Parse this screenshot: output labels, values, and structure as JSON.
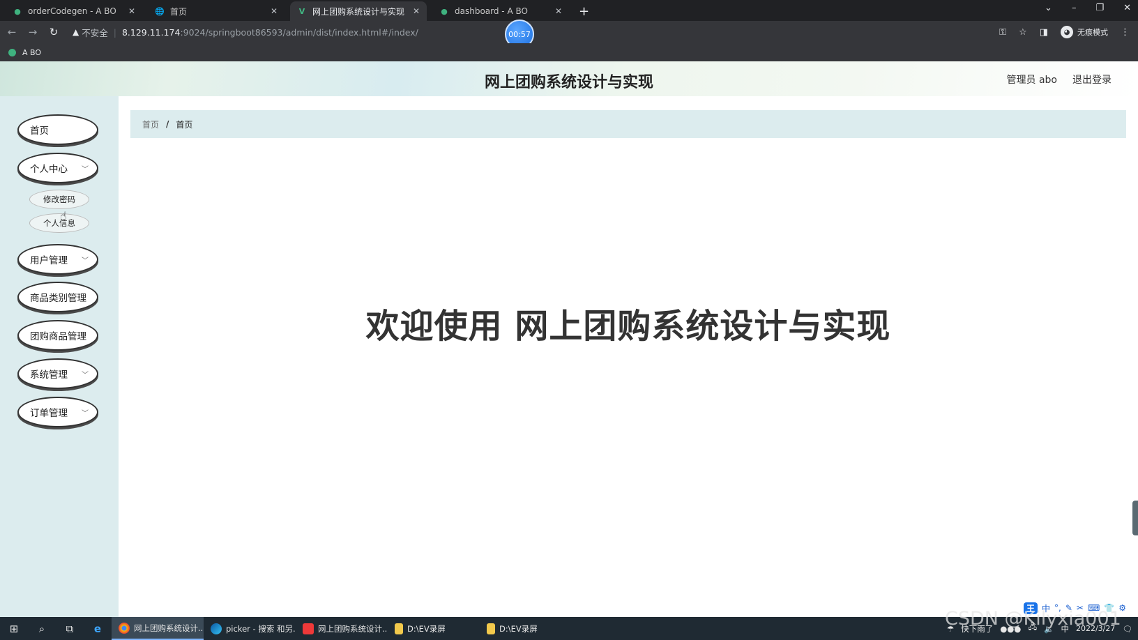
{
  "browser": {
    "tabs": [
      {
        "label": "orderCodegen - A BO",
        "active": false
      },
      {
        "label": "首页",
        "active": false
      },
      {
        "label": "网上团购系统设计与实现",
        "active": true
      },
      {
        "label": "dashboard - A BO",
        "active": false
      }
    ],
    "new_tab": "+",
    "address": {
      "insecure_label": "不安全",
      "host": "8.129.11.174",
      "path": ":9024/springboot86593/admin/dist/index.html#/index/"
    },
    "incognito_label": "无痕模式",
    "timer": "00:57",
    "bookmark": "A BO"
  },
  "app": {
    "title": "网上团购系统设计与实现",
    "user_label": "管理员 abo",
    "logout_label": "退出登录"
  },
  "sidebar": {
    "items": [
      {
        "label": "首页",
        "has_submenu": false
      },
      {
        "label": "个人中心",
        "has_submenu": true,
        "expanded": true,
        "children": [
          {
            "label": "修改密码"
          },
          {
            "label": "个人信息"
          }
        ]
      },
      {
        "label": "用户管理",
        "has_submenu": true
      },
      {
        "label": "商品类别管理",
        "has_submenu": false
      },
      {
        "label": "团购商品管理",
        "has_submenu": false
      },
      {
        "label": "系统管理",
        "has_submenu": true
      },
      {
        "label": "订单管理",
        "has_submenu": true
      }
    ]
  },
  "breadcrumb": {
    "home": "首页",
    "separator": "/",
    "current": "首页"
  },
  "main": {
    "welcome": "欢迎使用 网上团购系统设计与实现"
  },
  "taskbar": {
    "apps": [
      {
        "label": "网上团购系统设计...",
        "active": true
      },
      {
        "label": "picker - 搜索 和另...",
        "active": false
      },
      {
        "label": "网上团购系统设计...",
        "active": false
      },
      {
        "label": "D:\\EV录屏",
        "active": false
      },
      {
        "label": "D:\\EV录屏",
        "active": false
      }
    ],
    "weather": "快下雨了",
    "ime": "中",
    "date": "2022/3/27"
  },
  "watermark": "CSDN @Kilyxia001",
  "colors": {
    "sidebar_bg": "#dcecee",
    "breadcrumb_bg": "#dcecee",
    "chrome_dark": "#202124",
    "taskbar_bg": "#1f2a33"
  }
}
